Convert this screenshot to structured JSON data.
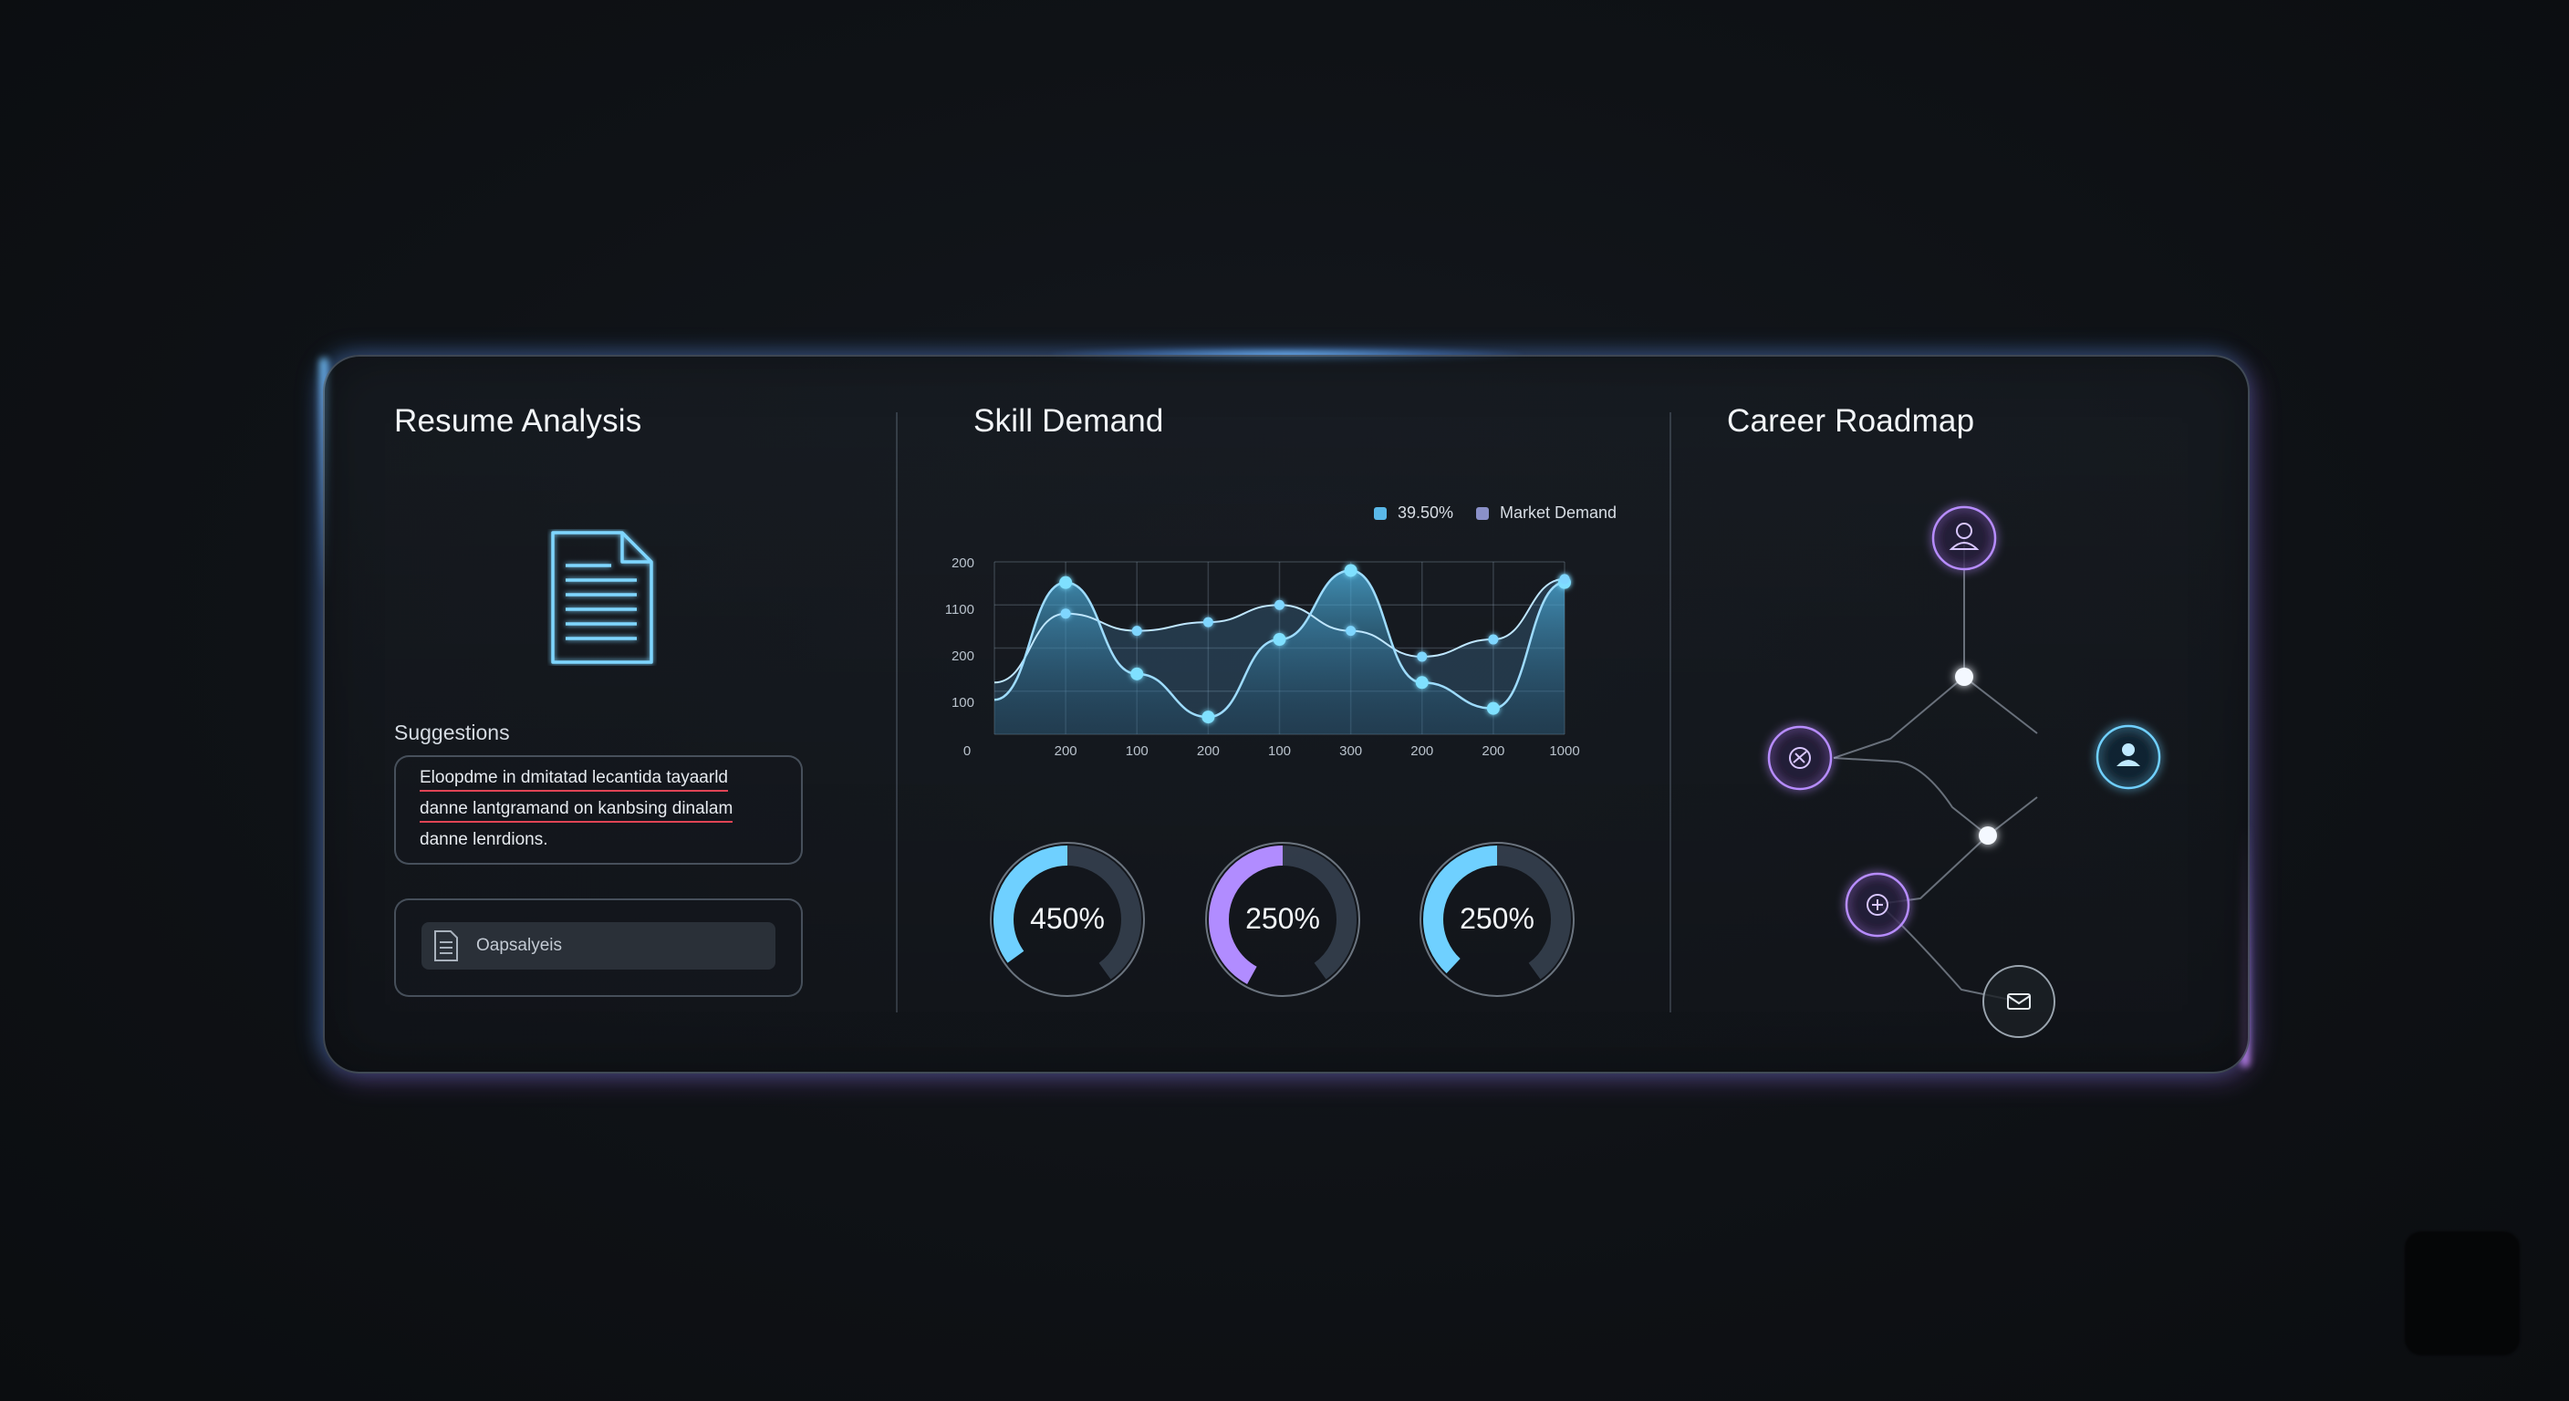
{
  "resume": {
    "title": "Resume Analysis",
    "suggestions_label": "Suggestions",
    "suggestions": [
      "Eloopdme in dmitatad lecantida tayaarld",
      "danne lantgramand on kanbsing dinalam",
      "danne lenrdions."
    ],
    "action_label": "Oapsalyeis"
  },
  "skill": {
    "title": "Skill Demand",
    "legend": [
      {
        "label": "39.50%",
        "color": "#5ab8e8"
      },
      {
        "label": "Market Demand",
        "color": "#8a90c8"
      }
    ],
    "rings": [
      {
        "label": "450%",
        "color": "#6fd0ff",
        "fraction": 0.35
      },
      {
        "label": "250%",
        "color": "#b18cff",
        "fraction": 0.42
      },
      {
        "label": "250%",
        "color": "#6fd0ff",
        "fraction": 0.38
      }
    ]
  },
  "roadmap": {
    "title": "Career Roadmap",
    "nodes": [
      {
        "name": "roadmap-node-person-top",
        "icon": "user-icon",
        "color": "#b78cff"
      },
      {
        "name": "roadmap-node-badge-left",
        "icon": "badge-icon",
        "color": "#b78cff"
      },
      {
        "name": "roadmap-node-person-right",
        "icon": "user-icon",
        "color": "#6fd0ff"
      },
      {
        "name": "roadmap-node-target",
        "icon": "target-icon",
        "color": "#b78cff"
      },
      {
        "name": "roadmap-node-mail",
        "icon": "mail-icon",
        "color": "#c9d1da"
      }
    ]
  },
  "chart_data": {
    "type": "line",
    "title": "",
    "xlabel": "",
    "ylabel": "",
    "x_ticks": [
      "0",
      "200",
      "100",
      "200",
      "100",
      "300",
      "200",
      "200",
      "1000"
    ],
    "y_ticks": [
      "200",
      "1100",
      "200",
      "100"
    ],
    "categories": [
      "0",
      "200",
      "100",
      "200",
      "100",
      "300",
      "200",
      "200",
      "1000"
    ],
    "series": [
      {
        "name": "39.50%",
        "values": [
          20,
          88,
          35,
          10,
          55,
          95,
          30,
          15,
          88
        ]
      },
      {
        "name": "Market Demand",
        "values": [
          30,
          70,
          60,
          65,
          75,
          60,
          45,
          55,
          90
        ]
      }
    ],
    "ylim": [
      0,
      100
    ],
    "grid": true,
    "legend_position": "top-right"
  }
}
